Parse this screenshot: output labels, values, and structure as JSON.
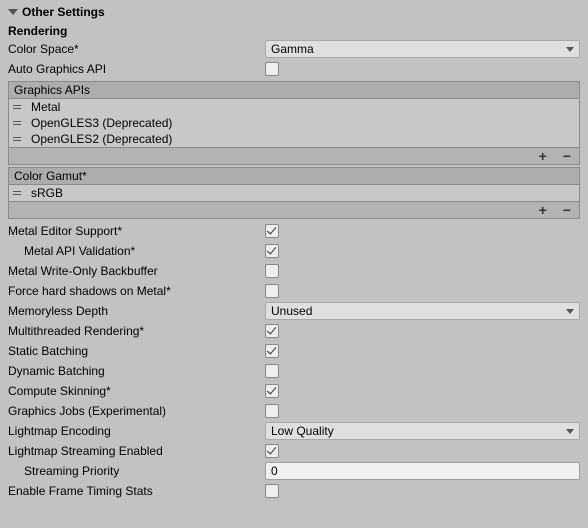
{
  "header": {
    "title": "Other Settings"
  },
  "section": {
    "title": "Rendering"
  },
  "color_space": {
    "label": "Color Space*",
    "value": "Gamma"
  },
  "auto_graphics_api": {
    "label": "Auto Graphics API",
    "checked": false
  },
  "graphics_apis": {
    "header": "Graphics APIs",
    "items": [
      "Metal",
      "OpenGLES3 (Deprecated)",
      "OpenGLES2 (Deprecated)"
    ]
  },
  "color_gamut": {
    "header": "Color Gamut*",
    "items": [
      "sRGB"
    ]
  },
  "metal_editor_support": {
    "label": "Metal Editor Support*",
    "checked": true
  },
  "metal_api_validation": {
    "label": "Metal API Validation*",
    "checked": true
  },
  "metal_write_only_backbuffer": {
    "label": "Metal Write-Only Backbuffer",
    "checked": false
  },
  "force_hard_shadows": {
    "label": "Force hard shadows on Metal*",
    "checked": false
  },
  "memoryless_depth": {
    "label": "Memoryless Depth",
    "value": "Unused"
  },
  "multithreaded_rendering": {
    "label": "Multithreaded Rendering*",
    "checked": true
  },
  "static_batching": {
    "label": "Static Batching",
    "checked": true
  },
  "dynamic_batching": {
    "label": "Dynamic Batching",
    "checked": false
  },
  "compute_skinning": {
    "label": "Compute Skinning*",
    "checked": true
  },
  "graphics_jobs": {
    "label": "Graphics Jobs (Experimental)",
    "checked": false
  },
  "lightmap_encoding": {
    "label": "Lightmap Encoding",
    "value": "Low Quality"
  },
  "lightmap_streaming_enabled": {
    "label": "Lightmap Streaming Enabled",
    "checked": true
  },
  "streaming_priority": {
    "label": "Streaming Priority",
    "value": "0"
  },
  "enable_frame_timing_stats": {
    "label": "Enable Frame Timing Stats",
    "checked": false
  }
}
